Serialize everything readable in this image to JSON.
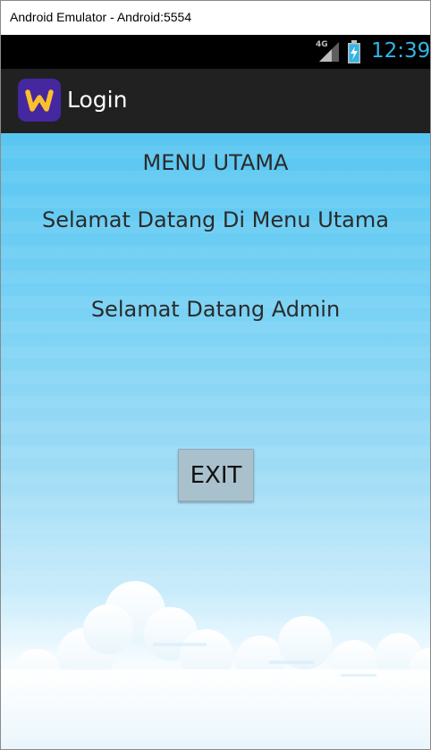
{
  "window": {
    "title": "Android Emulator - Android:5554"
  },
  "status_bar": {
    "network_type": "4G",
    "time": "12:39",
    "icons": [
      "signal-icon",
      "battery-charging-icon"
    ],
    "time_color": "#33b5e5"
  },
  "action_bar": {
    "title": "Login",
    "icon": "app-logo-icon",
    "icon_bg_color": "#4527a0",
    "icon_fg_color": "#fbc02d"
  },
  "main": {
    "heading": "MENU UTAMA",
    "welcome_menu": "Selamat Datang Di Menu Utama",
    "welcome_user": "Selamat Datang Admin",
    "exit_button": "EXIT"
  },
  "colors": {
    "sky_top": "#58c6f1",
    "sky_bottom": "#ffffff",
    "button_bg": "#a9c1cd"
  }
}
